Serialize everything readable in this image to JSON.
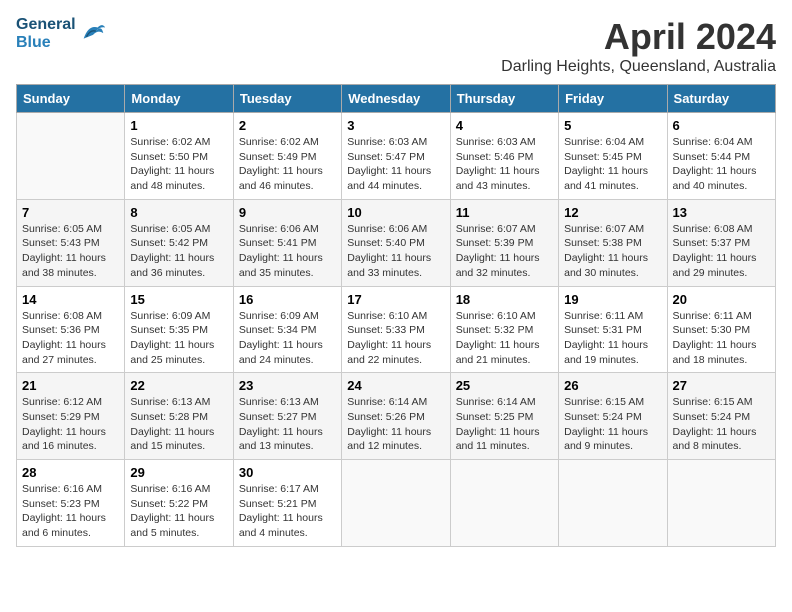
{
  "logo": {
    "line1": "General",
    "line2": "Blue"
  },
  "title": "April 2024",
  "location": "Darling Heights, Queensland, Australia",
  "headers": [
    "Sunday",
    "Monday",
    "Tuesday",
    "Wednesday",
    "Thursday",
    "Friday",
    "Saturday"
  ],
  "weeks": [
    [
      {
        "day": "",
        "info": ""
      },
      {
        "day": "1",
        "info": "Sunrise: 6:02 AM\nSunset: 5:50 PM\nDaylight: 11 hours\nand 48 minutes."
      },
      {
        "day": "2",
        "info": "Sunrise: 6:02 AM\nSunset: 5:49 PM\nDaylight: 11 hours\nand 46 minutes."
      },
      {
        "day": "3",
        "info": "Sunrise: 6:03 AM\nSunset: 5:47 PM\nDaylight: 11 hours\nand 44 minutes."
      },
      {
        "day": "4",
        "info": "Sunrise: 6:03 AM\nSunset: 5:46 PM\nDaylight: 11 hours\nand 43 minutes."
      },
      {
        "day": "5",
        "info": "Sunrise: 6:04 AM\nSunset: 5:45 PM\nDaylight: 11 hours\nand 41 minutes."
      },
      {
        "day": "6",
        "info": "Sunrise: 6:04 AM\nSunset: 5:44 PM\nDaylight: 11 hours\nand 40 minutes."
      }
    ],
    [
      {
        "day": "7",
        "info": "Sunrise: 6:05 AM\nSunset: 5:43 PM\nDaylight: 11 hours\nand 38 minutes."
      },
      {
        "day": "8",
        "info": "Sunrise: 6:05 AM\nSunset: 5:42 PM\nDaylight: 11 hours\nand 36 minutes."
      },
      {
        "day": "9",
        "info": "Sunrise: 6:06 AM\nSunset: 5:41 PM\nDaylight: 11 hours\nand 35 minutes."
      },
      {
        "day": "10",
        "info": "Sunrise: 6:06 AM\nSunset: 5:40 PM\nDaylight: 11 hours\nand 33 minutes."
      },
      {
        "day": "11",
        "info": "Sunrise: 6:07 AM\nSunset: 5:39 PM\nDaylight: 11 hours\nand 32 minutes."
      },
      {
        "day": "12",
        "info": "Sunrise: 6:07 AM\nSunset: 5:38 PM\nDaylight: 11 hours\nand 30 minutes."
      },
      {
        "day": "13",
        "info": "Sunrise: 6:08 AM\nSunset: 5:37 PM\nDaylight: 11 hours\nand 29 minutes."
      }
    ],
    [
      {
        "day": "14",
        "info": "Sunrise: 6:08 AM\nSunset: 5:36 PM\nDaylight: 11 hours\nand 27 minutes."
      },
      {
        "day": "15",
        "info": "Sunrise: 6:09 AM\nSunset: 5:35 PM\nDaylight: 11 hours\nand 25 minutes."
      },
      {
        "day": "16",
        "info": "Sunrise: 6:09 AM\nSunset: 5:34 PM\nDaylight: 11 hours\nand 24 minutes."
      },
      {
        "day": "17",
        "info": "Sunrise: 6:10 AM\nSunset: 5:33 PM\nDaylight: 11 hours\nand 22 minutes."
      },
      {
        "day": "18",
        "info": "Sunrise: 6:10 AM\nSunset: 5:32 PM\nDaylight: 11 hours\nand 21 minutes."
      },
      {
        "day": "19",
        "info": "Sunrise: 6:11 AM\nSunset: 5:31 PM\nDaylight: 11 hours\nand 19 minutes."
      },
      {
        "day": "20",
        "info": "Sunrise: 6:11 AM\nSunset: 5:30 PM\nDaylight: 11 hours\nand 18 minutes."
      }
    ],
    [
      {
        "day": "21",
        "info": "Sunrise: 6:12 AM\nSunset: 5:29 PM\nDaylight: 11 hours\nand 16 minutes."
      },
      {
        "day": "22",
        "info": "Sunrise: 6:13 AM\nSunset: 5:28 PM\nDaylight: 11 hours\nand 15 minutes."
      },
      {
        "day": "23",
        "info": "Sunrise: 6:13 AM\nSunset: 5:27 PM\nDaylight: 11 hours\nand 13 minutes."
      },
      {
        "day": "24",
        "info": "Sunrise: 6:14 AM\nSunset: 5:26 PM\nDaylight: 11 hours\nand 12 minutes."
      },
      {
        "day": "25",
        "info": "Sunrise: 6:14 AM\nSunset: 5:25 PM\nDaylight: 11 hours\nand 11 minutes."
      },
      {
        "day": "26",
        "info": "Sunrise: 6:15 AM\nSunset: 5:24 PM\nDaylight: 11 hours\nand 9 minutes."
      },
      {
        "day": "27",
        "info": "Sunrise: 6:15 AM\nSunset: 5:24 PM\nDaylight: 11 hours\nand 8 minutes."
      }
    ],
    [
      {
        "day": "28",
        "info": "Sunrise: 6:16 AM\nSunset: 5:23 PM\nDaylight: 11 hours\nand 6 minutes."
      },
      {
        "day": "29",
        "info": "Sunrise: 6:16 AM\nSunset: 5:22 PM\nDaylight: 11 hours\nand 5 minutes."
      },
      {
        "day": "30",
        "info": "Sunrise: 6:17 AM\nSunset: 5:21 PM\nDaylight: 11 hours\nand 4 minutes."
      },
      {
        "day": "",
        "info": ""
      },
      {
        "day": "",
        "info": ""
      },
      {
        "day": "",
        "info": ""
      },
      {
        "day": "",
        "info": ""
      }
    ]
  ]
}
